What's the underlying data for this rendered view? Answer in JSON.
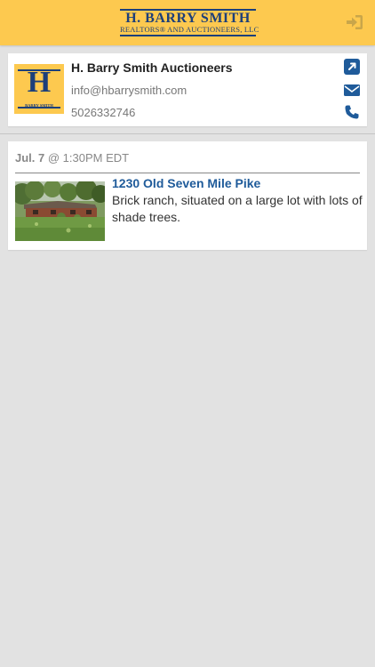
{
  "header": {
    "brand_name": "H. BARRY SMITH",
    "brand_sub": "REALTORS® AND AUCTIONEERS, LLC",
    "login_icon": "sign-in-icon",
    "background_color": "#fdc94f",
    "brand_color": "#1c3f7a"
  },
  "seller": {
    "logo_letter": "H",
    "logo_text": "BARRY SMITH",
    "name": "H. Barry Smith Auctioneers",
    "email": "info@hbarrysmith.com",
    "phone": "5026332746",
    "actions": [
      {
        "icon": "external-link-icon"
      },
      {
        "icon": "envelope-icon"
      },
      {
        "icon": "phone-icon"
      }
    ],
    "icon_color": "#1f5b9a"
  },
  "auction": {
    "date_day": "Jul. 7",
    "date_rest": " @ 1:30PM EDT",
    "listing": {
      "title": "1230 Old Seven Mile Pike",
      "description": "Brick ranch, situated on a large lot with lots of shade trees.",
      "title_color": "#1f5b9a"
    }
  }
}
